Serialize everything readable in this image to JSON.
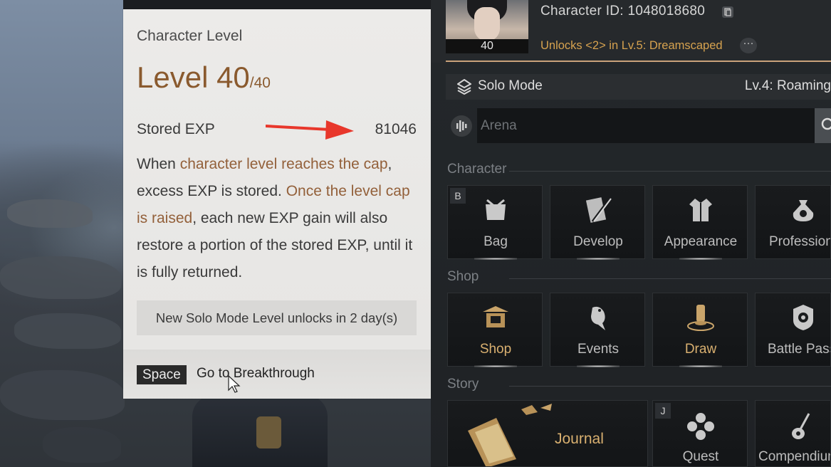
{
  "tooltip": {
    "section_label": "Character Level",
    "level_main": "Level 40",
    "level_cap": "/40",
    "exp_label": "Stored EXP",
    "exp_value": "81046",
    "desc": {
      "p1": "When ",
      "h1": "character level reaches the cap",
      "p2": ", excess EXP is stored. ",
      "h2": "Once the level cap is raised",
      "p3": ", each new EXP gain will also restore a portion of the stored EXP, until it is fully returned."
    },
    "unlock_notice": "New Solo Mode Level unlocks in 2 day(s)",
    "hotkey": "Space",
    "action": "Go to Breakthrough"
  },
  "profile": {
    "level": "40",
    "character_id": "Character ID: 1048018680",
    "unlock_text": "Unlocks <2> in Lv.5: Dreamscaped",
    "more_label": "···"
  },
  "solo_mode": {
    "label": "Solo Mode",
    "level": "Lv.4: Roaming"
  },
  "search": {
    "placeholder": "Arena"
  },
  "categories": {
    "character": {
      "label": "Character",
      "tiles": [
        {
          "label": "Bag",
          "hotkey": "B",
          "icon": "bag-icon"
        },
        {
          "label": "Develop",
          "icon": "develop-icon"
        },
        {
          "label": "Appearance",
          "icon": "appearance-icon"
        },
        {
          "label": "Profession",
          "icon": "profession-icon"
        }
      ]
    },
    "shop": {
      "label": "Shop",
      "tiles": [
        {
          "label": "Shop",
          "icon": "shop-icon"
        },
        {
          "label": "Events",
          "icon": "events-icon"
        },
        {
          "label": "Draw",
          "icon": "draw-icon"
        },
        {
          "label": "Battle Pass",
          "icon": "battle-pass-icon"
        }
      ]
    },
    "story": {
      "label": "Story",
      "tiles": [
        {
          "label": "Journal",
          "icon": "journal-icon"
        },
        {
          "label": "Quest",
          "hotkey": "J",
          "icon": "quest-icon"
        },
        {
          "label": "Compendium",
          "icon": "compendium-icon"
        }
      ]
    }
  },
  "colors": {
    "accent_gold": "#d9b070",
    "highlight_brown": "#93603a",
    "arrow_red": "#e8372b"
  }
}
